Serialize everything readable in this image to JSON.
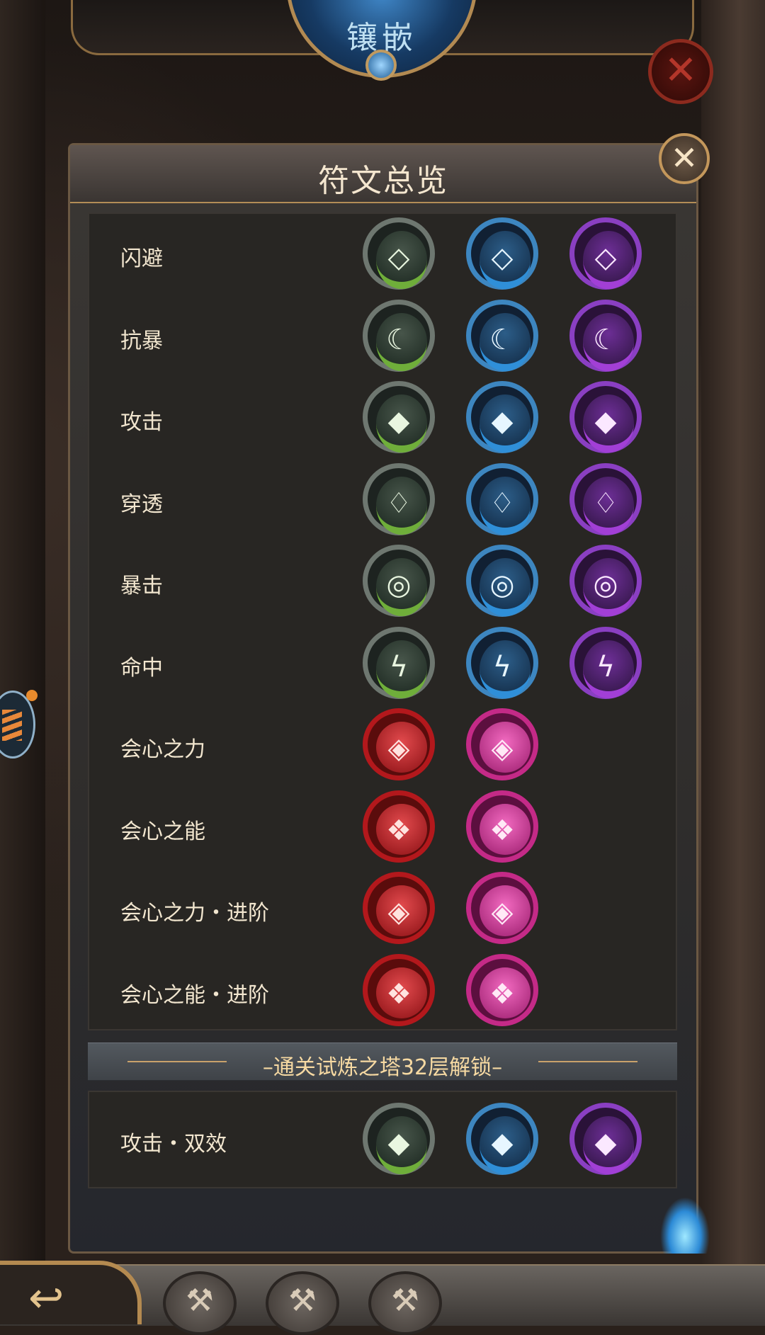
{
  "header": {
    "title": "镶嵌",
    "close_icon": "✕"
  },
  "panel": {
    "title": "符文总览",
    "close_icon": "✕",
    "unlock_text": "–通关试炼之塔32层解锁–"
  },
  "rows": [
    {
      "label": "闪避",
      "runes": [
        {
          "color": "green",
          "symbol": "◇"
        },
        {
          "color": "blue",
          "symbol": "◇"
        },
        {
          "color": "purple",
          "symbol": "◇"
        }
      ]
    },
    {
      "label": "抗暴",
      "runes": [
        {
          "color": "green",
          "symbol": "☾"
        },
        {
          "color": "blue",
          "symbol": "☾"
        },
        {
          "color": "purple",
          "symbol": "☾"
        }
      ]
    },
    {
      "label": "攻击",
      "runes": [
        {
          "color": "green",
          "symbol": "◆"
        },
        {
          "color": "blue",
          "symbol": "◆"
        },
        {
          "color": "purple",
          "symbol": "◆"
        }
      ]
    },
    {
      "label": "穿透",
      "runes": [
        {
          "color": "green",
          "symbol": "♢"
        },
        {
          "color": "blue",
          "symbol": "♢"
        },
        {
          "color": "purple",
          "symbol": "♢"
        }
      ]
    },
    {
      "label": "暴击",
      "runes": [
        {
          "color": "green",
          "symbol": "◎"
        },
        {
          "color": "blue",
          "symbol": "◎"
        },
        {
          "color": "purple",
          "symbol": "◎"
        }
      ]
    },
    {
      "label": "命中",
      "runes": [
        {
          "color": "green",
          "symbol": "ϟ"
        },
        {
          "color": "blue",
          "symbol": "ϟ"
        },
        {
          "color": "purple",
          "symbol": "ϟ"
        }
      ]
    },
    {
      "label": "会心之力",
      "runes": [
        {
          "color": "red",
          "symbol": "◈"
        },
        {
          "color": "magenta",
          "symbol": "◈"
        }
      ]
    },
    {
      "label": "会心之能",
      "runes": [
        {
          "color": "red",
          "symbol": "❖"
        },
        {
          "color": "magenta",
          "symbol": "❖"
        }
      ]
    },
    {
      "label": "会心之力・进阶",
      "runes": [
        {
          "color": "red",
          "symbol": "◈"
        },
        {
          "color": "magenta",
          "symbol": "◈"
        }
      ]
    },
    {
      "label": "会心之能・进阶",
      "runes": [
        {
          "color": "red",
          "symbol": "❖"
        },
        {
          "color": "magenta",
          "symbol": "❖"
        }
      ]
    }
  ],
  "bonus_row": {
    "label": "攻击・双效",
    "runes": [
      {
        "color": "green",
        "symbol": "◆"
      },
      {
        "color": "blue",
        "symbol": "◆"
      },
      {
        "color": "purple",
        "symbol": "◆"
      }
    ]
  },
  "bottom_bar": {
    "back_icon": "↩",
    "tool_icons": [
      "hammer-icon",
      "hammer-icon",
      "hammer-icon"
    ],
    "tool_glyph": "⚒"
  }
}
